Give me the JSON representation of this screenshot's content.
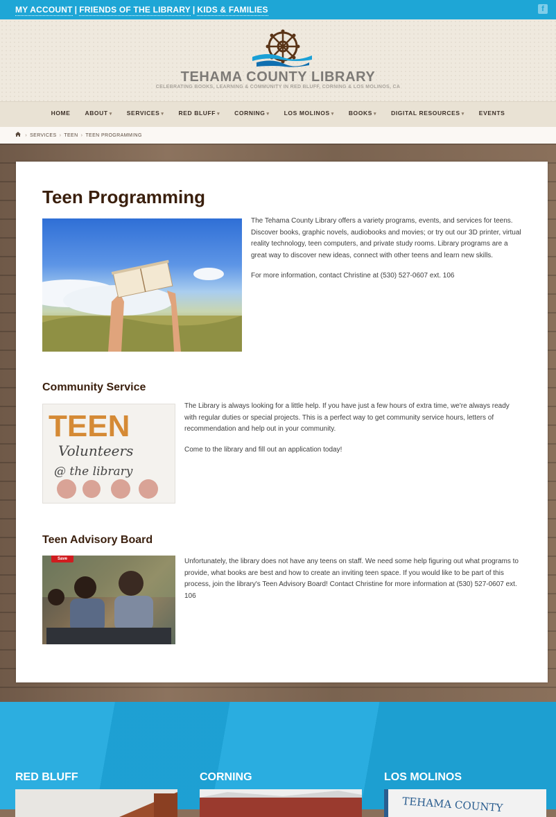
{
  "topbar": {
    "links": [
      "MY ACCOUNT",
      "FRIENDS OF THE LIBRARY",
      "KIDS & FAMILIES"
    ]
  },
  "header": {
    "brand": "TEHAMA COUNTY LIBRARY",
    "tagline": "CELEBRATING BOOKS, LEARNING & COMMUNITY IN RED BLUFF, CORNING & LOS MOLINOS, CA"
  },
  "nav": {
    "items": [
      {
        "label": "HOME",
        "dropdown": false
      },
      {
        "label": "ABOUT",
        "dropdown": true
      },
      {
        "label": "SERVICES",
        "dropdown": true
      },
      {
        "label": "RED BLUFF",
        "dropdown": true
      },
      {
        "label": "CORNING",
        "dropdown": true
      },
      {
        "label": "LOS MOLINOS",
        "dropdown": true
      },
      {
        "label": "BOOKS",
        "dropdown": true
      },
      {
        "label": "DIGITAL RESOURCES",
        "dropdown": true
      },
      {
        "label": "EVENTS",
        "dropdown": false
      }
    ]
  },
  "breadcrumb": {
    "home_icon": "home-icon",
    "items": [
      "SERVICES",
      "TEEN",
      "TEEN PROGRAMMING"
    ]
  },
  "page": {
    "title": "Teen Programming",
    "intro": [
      "The Tehama County Library offers a variety programs, events, and services for teens. Discover books, graphic novels, audiobooks and movies; or try out our 3D printer, virtual reality technology, teen computers, and private study rooms. Library programs are a great way to discover new ideas, connect with other teens and learn new skills.",
      "For more information, contact Christine at (530) 527-0607 ext. 106"
    ],
    "community": {
      "title": "Community Service",
      "paragraphs": [
        "The Library is always looking for a little help. If you have just a few hours of extra time, we're always ready with regular duties or special projects. This is a perfect way to get community service hours, letters of recommendation and help out in your community.",
        "Come to the library and fill out an application today!"
      ],
      "image_text": {
        "line1": "TEEN",
        "line2": "Volunteers",
        "line3": "@ the library"
      }
    },
    "advisory": {
      "title": "Teen Advisory Board",
      "paragraphs": [
        "Unfortunately, the library does not have any teens on staff. We need some help figuring out what programs to provide, what books are best and how to create an inviting teen space. If you would like to be part of this process, join the library's Teen Advisory Board! Contact Christine for more information at (530) 527-0607 ext. 106"
      ],
      "save_badge": "Save"
    }
  },
  "footer": {
    "columns": [
      {
        "title": "RED BLUFF"
      },
      {
        "title": "CORNING"
      },
      {
        "title": "LOS MOLINOS",
        "sign_text": "TEHAMA COUNTY"
      }
    ]
  },
  "colors": {
    "accent_blue": "#1ea6d6",
    "heading_brown": "#3a1f0d",
    "save_red": "#d01c1f"
  }
}
